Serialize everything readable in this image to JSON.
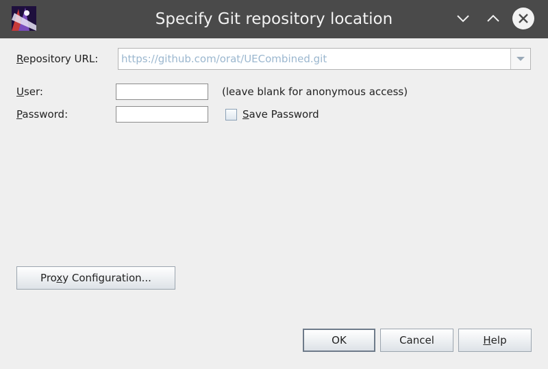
{
  "window": {
    "title": "Specify Git repository location",
    "controls": {
      "minimize_icon": "chevron-down-icon",
      "maximize_icon": "chevron-up-icon",
      "close_icon": "close-icon"
    }
  },
  "form": {
    "repo_url": {
      "label_hotkey": "R",
      "label_rest": "epository URL:",
      "value": "https://github.com/orat/UECombined.git"
    },
    "user": {
      "label_hotkey": "U",
      "label_rest": "ser:",
      "value": "",
      "hint": "(leave blank for anonymous access)"
    },
    "password": {
      "label_hotkey": "P",
      "label_rest": "assword:",
      "value": "",
      "save_hotkey": "S",
      "save_rest": "ave Password",
      "save_checked": false
    }
  },
  "buttons": {
    "proxy_prefix": "Pro",
    "proxy_hotkey": "x",
    "proxy_rest": "y Configuration...",
    "ok": "OK",
    "cancel": "Cancel",
    "help_hotkey": "H",
    "help_rest": "elp"
  },
  "colors": {
    "titlebar": "#4a4a4a",
    "dialog_bg": "#efefef",
    "url_text": "#9bb7cf"
  }
}
